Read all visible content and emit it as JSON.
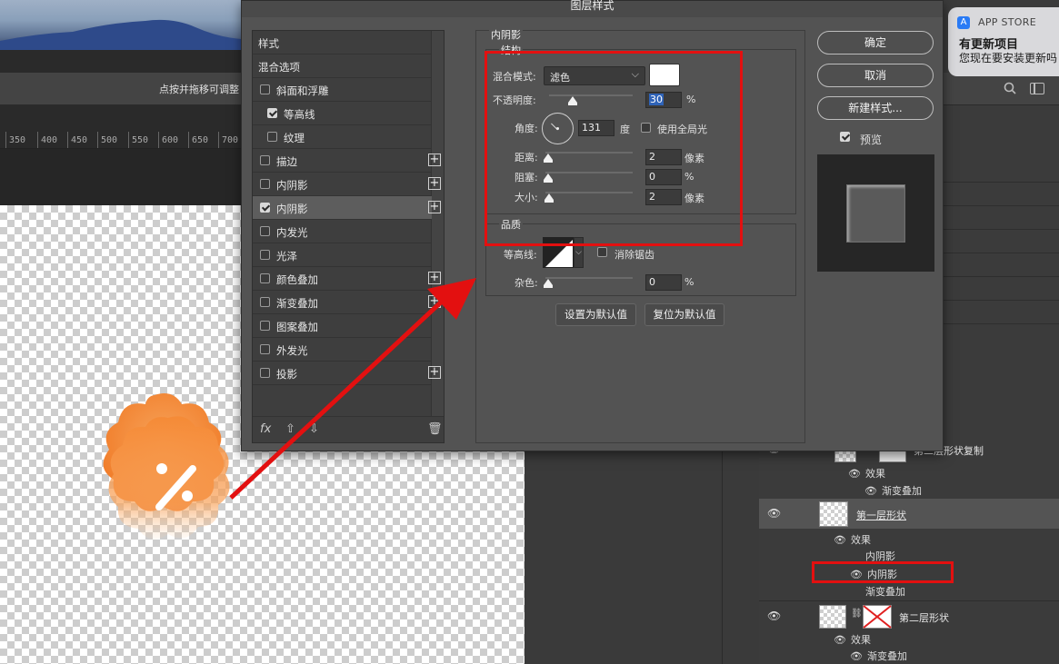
{
  "workspace": {
    "options_hint": "点按并拖移可调整",
    "ruler_ticks": [
      "350",
      "400",
      "450",
      "500",
      "550",
      "600",
      "650",
      "700"
    ]
  },
  "notification": {
    "app": "APP STORE",
    "title": "有更新项目",
    "message": "您现在要安装更新吗"
  },
  "dialog": {
    "title": "图层样式",
    "style_list": [
      {
        "label": "样式",
        "type": "header",
        "checked": null,
        "plus": false,
        "selected": false
      },
      {
        "label": "混合选项",
        "type": "header",
        "checked": null,
        "plus": false,
        "selected": false
      },
      {
        "label": "斜面和浮雕",
        "type": "item",
        "checked": false,
        "plus": false,
        "selected": false
      },
      {
        "label": "等高线",
        "type": "sub",
        "checked": true,
        "plus": false,
        "selected": false
      },
      {
        "label": "纹理",
        "type": "sub",
        "checked": false,
        "plus": false,
        "selected": false
      },
      {
        "label": "描边",
        "type": "item",
        "checked": false,
        "plus": true,
        "selected": false
      },
      {
        "label": "内阴影",
        "type": "item",
        "checked": false,
        "plus": true,
        "selected": false
      },
      {
        "label": "内阴影",
        "type": "item",
        "checked": true,
        "plus": true,
        "selected": true
      },
      {
        "label": "内发光",
        "type": "item",
        "checked": false,
        "plus": false,
        "selected": false
      },
      {
        "label": "光泽",
        "type": "item",
        "checked": false,
        "plus": false,
        "selected": false
      },
      {
        "label": "颜色叠加",
        "type": "item",
        "checked": false,
        "plus": true,
        "selected": false
      },
      {
        "label": "渐变叠加",
        "type": "item",
        "checked": false,
        "plus": true,
        "selected": false
      },
      {
        "label": "图案叠加",
        "type": "item",
        "checked": false,
        "plus": false,
        "selected": false
      },
      {
        "label": "外发光",
        "type": "item",
        "checked": false,
        "plus": false,
        "selected": false
      },
      {
        "label": "投影",
        "type": "item",
        "checked": false,
        "plus": true,
        "selected": false
      }
    ],
    "footer_fx": "fx",
    "section_title": "内阴影",
    "structure": {
      "legend": "结构",
      "blend_mode_label": "混合模式:",
      "blend_mode_value": "滤色",
      "blend_color": "#ffffff",
      "opacity_label": "不透明度:",
      "opacity_value": "30",
      "opacity_unit": "%",
      "angle_label": "角度:",
      "angle_value": "131",
      "angle_unit": "度",
      "global_light_label": "使用全局光",
      "global_light_checked": false,
      "distance_label": "距离:",
      "distance_value": "2",
      "distance_unit": "像素",
      "choke_label": "阻塞:",
      "choke_value": "0",
      "choke_unit": "%",
      "size_label": "大小:",
      "size_value": "2",
      "size_unit": "像素"
    },
    "quality": {
      "legend": "品质",
      "contour_label": "等高线:",
      "anti_alias_label": "消除锯齿",
      "anti_alias_checked": false,
      "noise_label": "杂色:",
      "noise_value": "0",
      "noise_unit": "%"
    },
    "set_default": "设置为默认值",
    "reset_default": "复位为默认值",
    "ok": "确定",
    "cancel": "取消",
    "new_style": "新建样式...",
    "preview_label": "预览",
    "preview_checked": true
  },
  "layers": {
    "top_layer": "第二层形状复制",
    "top_effects_label": "效果",
    "top_effect_1": "渐变叠加",
    "selected_layer": "第一层形状",
    "sel_effects_label": "效果",
    "sel_effect_1": "内阴影",
    "sel_effect_2": "内阴影",
    "sel_effect_3": "渐变叠加",
    "bottom_layer": "第二层形状",
    "bottom_effects_label": "效果",
    "bottom_effect_1": "渐变叠加"
  },
  "colors": {
    "highlight_red": "#e31010",
    "badge_orange": "#f5842a"
  }
}
